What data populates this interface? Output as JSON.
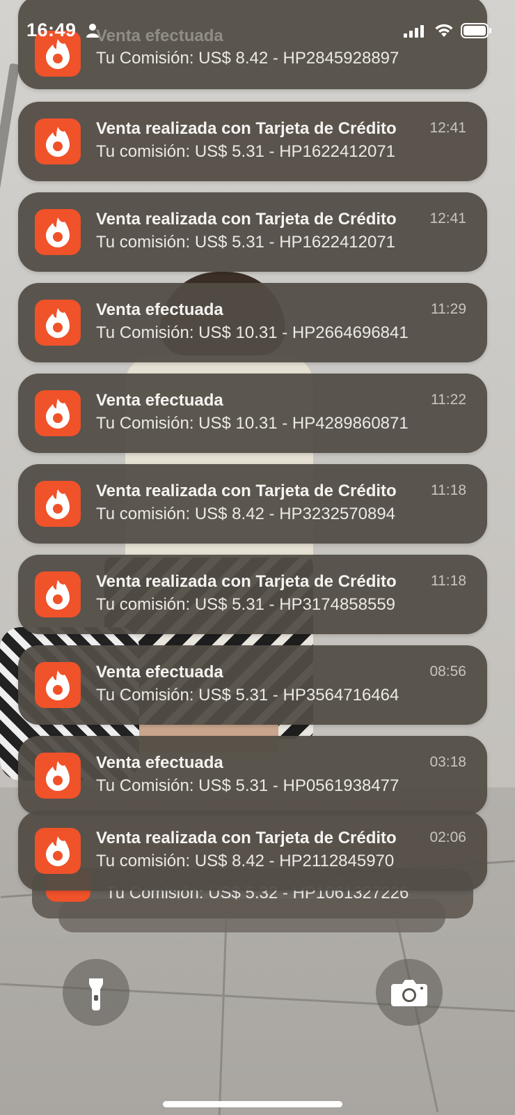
{
  "status_bar": {
    "time": "16:49",
    "icons": [
      "person-icon",
      "cellular-signal-icon",
      "wifi-icon",
      "battery-icon"
    ]
  },
  "app": {
    "icon": "hotmart-flame-icon",
    "brand_color": "#f0522a"
  },
  "notifications": [
    {
      "title": "Venta efectuada",
      "body": "Tu Comisión: US$ 8.42 - HP2845928897",
      "time": ""
    },
    {
      "title": "Venta realizada con Tarjeta de Crédito",
      "body": "Tu comisión: US$ 5.31 - HP1622412071",
      "time": "12:41"
    },
    {
      "title": "Venta realizada con Tarjeta de Crédito",
      "body": "Tu comisión: US$ 5.31 - HP1622412071",
      "time": "12:41"
    },
    {
      "title": "Venta efectuada",
      "body": "Tu Comisión: US$ 10.31 - HP2664696841",
      "time": "11:29"
    },
    {
      "title": "Venta efectuada",
      "body": "Tu Comisión: US$ 10.31 - HP4289860871",
      "time": "11:22"
    },
    {
      "title": "Venta realizada con Tarjeta de Crédito",
      "body": "Tu comisión: US$ 8.42 - HP3232570894",
      "time": "11:18"
    },
    {
      "title": "Venta realizada con Tarjeta de Crédito",
      "body": "Tu comisión: US$ 5.31 - HP3174858559",
      "time": "11:18"
    },
    {
      "title": "Venta efectuada",
      "body": "Tu Comisión: US$ 5.31 - HP3564716464",
      "time": "08:56"
    },
    {
      "title": "Venta efectuada",
      "body": "Tu Comisión: US$ 5.31 - HP0561938477",
      "time": "03:18"
    },
    {
      "title": "Venta realizada con Tarjeta de Crédito",
      "body": "Tu comisión: US$ 8.42 - HP2112845970",
      "time": "02:06"
    }
  ],
  "stacked_notification": {
    "body": "Tu Comisión: US$ 5.32 - HP1061327226"
  },
  "controls": {
    "left": "flashlight-icon",
    "right": "camera-icon"
  }
}
